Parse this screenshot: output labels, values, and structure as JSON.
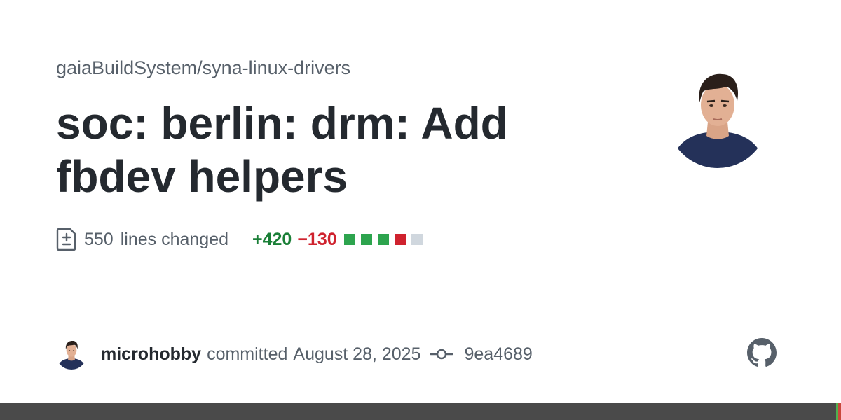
{
  "repo": "gaiaBuildSystem/syna-linux-drivers",
  "title": "soc: berlin: drm: Add fbdev helpers",
  "stats": {
    "count": "550",
    "label": "lines changed",
    "additions": "+420",
    "deletions": "−130",
    "squares": [
      "#2da44e",
      "#2da44e",
      "#2da44e",
      "#cf222e",
      "#d0d7de"
    ]
  },
  "footer": {
    "author": "microhobby",
    "action": "committed",
    "date": "August 28, 2025",
    "sha": "9ea4689"
  },
  "icons": {
    "diff": "file-diff-icon",
    "commit": "git-commit-icon",
    "brand": "github-logo-icon"
  },
  "colors": {
    "title": "#24292f",
    "muted": "#57606a",
    "additions": "#1a7f37",
    "deletions": "#cf222e",
    "bottom_bar": "#4a4a4a"
  }
}
